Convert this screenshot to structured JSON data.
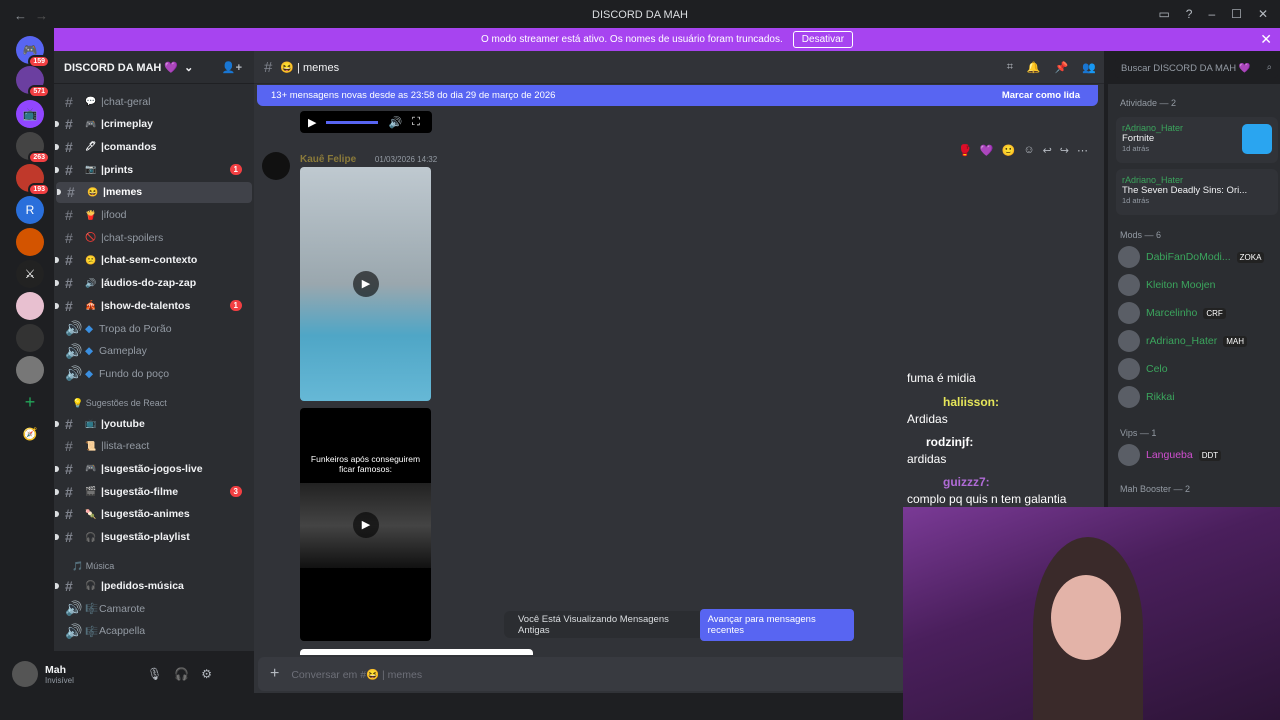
{
  "window": {
    "title": "DISCORD DA MAH",
    "nav_back": "←",
    "nav_fwd": "→",
    "icon_inbox": "▭",
    "icon_help": "?",
    "min": "–",
    "max": "☐",
    "close": "✕"
  },
  "streamer_bar": {
    "text": "O modo streamer está ativo. Os nomes de usuário foram truncados.",
    "button": "Desativar",
    "close": "✕"
  },
  "guilds": [
    {
      "badge": "159"
    },
    {
      "badge": "571"
    },
    {
      "badge": ""
    },
    {
      "badge": "263"
    },
    {
      "badge": "193"
    },
    {
      "badge": ""
    },
    {
      "badge": ""
    },
    {
      "badge": ""
    },
    {
      "badge": ""
    },
    {
      "badge": ""
    },
    {
      "badge": ""
    }
  ],
  "server": {
    "name": "DISCORD DA MAH 💜",
    "add_member": "👤+"
  },
  "channels": [
    {
      "name": "chat-geral",
      "emoji": "💬",
      "unread": false,
      "cnt": ""
    },
    {
      "name": "crimeplay",
      "emoji": "🎮",
      "unread": true,
      "cnt": ""
    },
    {
      "name": "comandos",
      "emoji": "🖊",
      "unread": true,
      "cnt": ""
    },
    {
      "name": "prints",
      "emoji": "📷",
      "unread": true,
      "cnt": "1"
    },
    {
      "name": "memes",
      "emoji": "😆",
      "unread": true,
      "cnt": "",
      "sel": true
    },
    {
      "name": "ifood",
      "emoji": "🍟",
      "unread": false,
      "cnt": ""
    },
    {
      "name": "chat-spoilers",
      "emoji": "🚫",
      "unread": false,
      "cnt": ""
    },
    {
      "name": "chat-sem-contexto",
      "emoji": "😕",
      "unread": true,
      "cnt": ""
    },
    {
      "name": "áudios-do-zap-zap",
      "emoji": "🔊",
      "unread": true,
      "cnt": ""
    },
    {
      "name": "show-de-talentos",
      "emoji": "🎪",
      "unread": true,
      "cnt": "1"
    }
  ],
  "voice": [
    {
      "name": "Tropa do Porão"
    },
    {
      "name": "Gameplay"
    },
    {
      "name": "Fundo do poço"
    }
  ],
  "cat_suggest": "💡 Sugestões de React",
  "channels2": [
    {
      "name": "youtube",
      "emoji": "📺",
      "unread": true,
      "cnt": ""
    },
    {
      "name": "lista-react",
      "emoji": "📜",
      "unread": false,
      "cnt": ""
    },
    {
      "name": "sugestão-jogos-live",
      "emoji": "🎮",
      "unread": true,
      "cnt": ""
    },
    {
      "name": "sugestão-filme",
      "emoji": "🎬",
      "unread": true,
      "cnt": "3"
    },
    {
      "name": "sugestão-animes",
      "emoji": "🍡",
      "unread": true,
      "cnt": ""
    },
    {
      "name": "sugestão-playlist",
      "emoji": "🎧",
      "unread": true,
      "cnt": ""
    }
  ],
  "cat_music": "🎵 Música",
  "channels3": [
    {
      "name": "pedidos-música",
      "emoji": "🎧",
      "unread": true
    }
  ],
  "voice2": [
    {
      "name": "Camarote"
    },
    {
      "name": "Acappella"
    }
  ],
  "user": {
    "name": "Mah",
    "status": "Invisível"
  },
  "topbar": {
    "channel": "😆 | memes"
  },
  "banner": {
    "text": "13+ mensagens novas desde as 23:58 do dia 29 de março de 2026",
    "mark": "Marcar como lida"
  },
  "message": {
    "author": "Kauê Felipe",
    "timestamp": "01/03/2026 14:32",
    "video2_text": "Funkeiros após conseguirem ficar famosos:"
  },
  "jump": {
    "text": "Você Está Visualizando Mensagens Antigas",
    "button": "Avançar para mensagens recentes"
  },
  "composer": {
    "placeholder": "Conversar em #😆 | memes"
  },
  "search": {
    "placeholder": "Buscar DISCORD DA MAH 💜"
  },
  "members": {
    "activity": "Atividade — 2",
    "act": [
      {
        "name": "rAdriano_Hater",
        "game": "Fortnite",
        "time": "1d atrás"
      },
      {
        "name": "rAdriano_Hater",
        "game": "The Seven Deadly Sins: Ori...",
        "time": "1d atrás"
      }
    ],
    "mods_h": "Mods — 6",
    "mods": [
      {
        "name": "DabiFanDoModi...",
        "tag": "ZOKA",
        "color": "#3ba55d"
      },
      {
        "name": "Kleiton Moojen",
        "tag": "",
        "color": "#3ba55d"
      },
      {
        "name": "Marcelinho",
        "tag": "CRF",
        "color": "#3ba55d"
      },
      {
        "name": "rAdriano_Hater",
        "tag": "MAH",
        "color": "#3ba55d"
      },
      {
        "name": "Celo",
        "tag": "",
        "color": "#3ba55d"
      },
      {
        "name": "Rikkai",
        "tag": "",
        "color": "#3ba55d"
      }
    ],
    "vips_h": "Vips — 1",
    "vips": [
      {
        "name": "Langueba",
        "tag": "DDT",
        "color": "#d14fd1"
      }
    ],
    "booster_h": "Mah Booster — 2"
  },
  "stream_chat": [
    {
      "user": "",
      "text": "fuma é midia"
    },
    {
      "user": "haliisson:",
      "text": "Ardidas"
    },
    {
      "user": "rodzinjf:",
      "text": "ardidas"
    },
    {
      "user": "guizzz7:",
      "text": "complo pq quis n tem galantia"
    }
  ]
}
